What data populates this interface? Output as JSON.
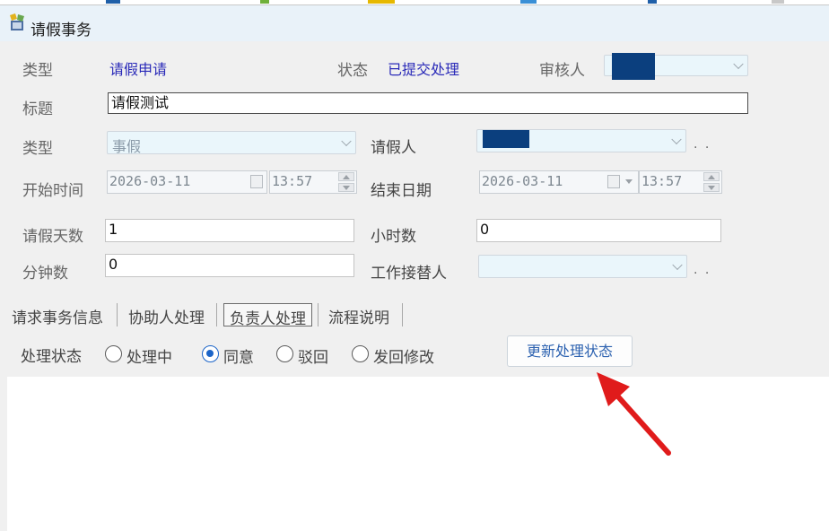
{
  "window": {
    "title": "请假事务"
  },
  "fields": {
    "type_label": "类型",
    "type_value": "请假申请",
    "status_label": "状态",
    "status_value": "已提交处理",
    "reviewer_label": "审核人",
    "title_label": "标题",
    "title_value": "请假测试",
    "leave_type_label": "类型",
    "leave_type_value": "事假",
    "applicant_label": "请假人",
    "start_label": "开始时间",
    "start_date": "2026-03-11",
    "start_time": "13:57",
    "end_label": "结束日期",
    "end_date": "2026-03-11",
    "end_time": "13:57",
    "days_label": "请假天数",
    "days_value": "1",
    "hours_label": "小时数",
    "hours_value": "0",
    "minutes_label": "分钟数",
    "minutes_value": "0",
    "substitute_label": "工作接替人",
    "more_dots": ". ."
  },
  "tabs": [
    {
      "label": "请求事务信息"
    },
    {
      "label": "协助人处理"
    },
    {
      "label": "负责人处理"
    },
    {
      "label": "流程说明"
    }
  ],
  "processing": {
    "label": "处理状态",
    "options": [
      "处理中",
      "同意",
      "驳回",
      "发回修改"
    ],
    "selected": "同意",
    "update_button": "更新处理状态"
  },
  "colors": {
    "accent_blue": "#2a2ab8",
    "redaction": "#0b3f7e",
    "arrow": "#e01b1b",
    "radio_checked": "#1b64c8"
  }
}
